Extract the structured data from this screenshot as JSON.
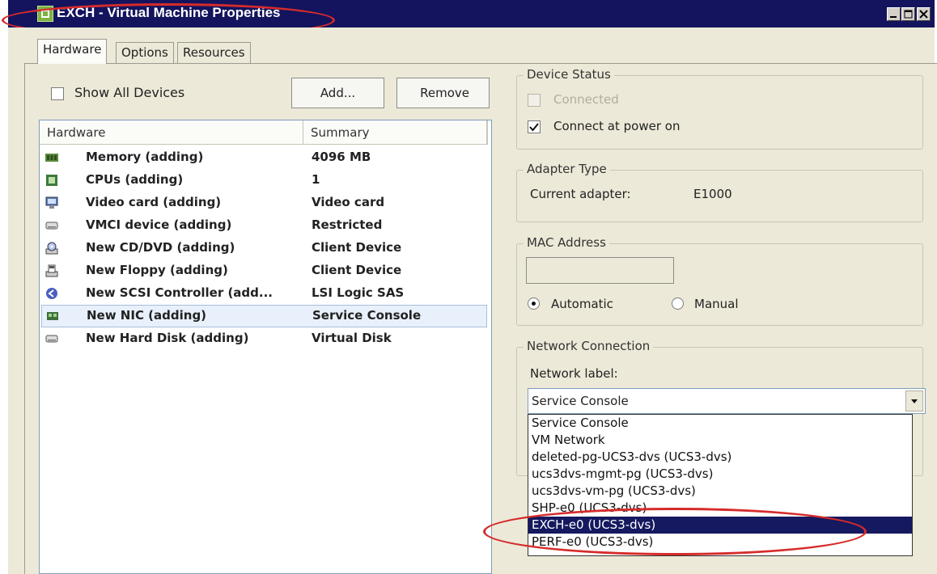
{
  "window": {
    "title": "EXCH - Virtual Machine Properties",
    "controls": {
      "minimize": "_",
      "maximize": "□",
      "close": "×"
    }
  },
  "tabs": [
    {
      "label": "Hardware",
      "active": true
    },
    {
      "label": "Options",
      "active": false
    },
    {
      "label": "Resources",
      "active": false
    }
  ],
  "hardware_panel": {
    "show_all_devices_label": "Show All Devices",
    "show_all_devices_checked": false,
    "add_button": "Add...",
    "remove_button": "Remove",
    "columns": [
      "Hardware",
      "Summary"
    ],
    "rows": [
      {
        "icon": "memory-icon",
        "name": "Memory (adding)",
        "summary": "4096 MB"
      },
      {
        "icon": "cpu-icon",
        "name": "CPUs (adding)",
        "summary": "1"
      },
      {
        "icon": "video-card-icon",
        "name": "Video card  (adding)",
        "summary": "Video card"
      },
      {
        "icon": "vmci-device-icon",
        "name": "VMCI device (adding)",
        "summary": "Restricted"
      },
      {
        "icon": "cd-dvd-icon",
        "name": "New CD/DVD (adding)",
        "summary": "Client Device"
      },
      {
        "icon": "floppy-icon",
        "name": "New Floppy (adding)",
        "summary": "Client Device"
      },
      {
        "icon": "scsi-controller-icon",
        "name": "New SCSI Controller (add...",
        "summary": "LSI Logic SAS"
      },
      {
        "icon": "nic-icon",
        "name": "New NIC (adding)",
        "summary": "Service Console",
        "selected": true
      },
      {
        "icon": "hard-disk-icon",
        "name": "New Hard Disk (adding)",
        "summary": "Virtual Disk"
      }
    ]
  },
  "device_status": {
    "legend": "Device Status",
    "connected_label": "Connected",
    "connected_checked": false,
    "connected_enabled": false,
    "connect_at_power_on_label": "Connect at power on",
    "connect_at_power_on_checked": true
  },
  "adapter_type": {
    "legend": "Adapter Type",
    "current_adapter_label": "Current adapter:",
    "current_adapter_value": "E1000"
  },
  "mac_address": {
    "legend": "MAC Address",
    "value": "",
    "automatic_label": "Automatic",
    "manual_label": "Manual",
    "selected": "Automatic"
  },
  "network_connection": {
    "legend": "Network Connection",
    "network_label": "Network label:",
    "selected_value": "Service Console",
    "options": [
      "Service Console",
      "VM Network",
      "deleted-pg-UCS3-dvs (UCS3-dvs)",
      "ucs3dvs-mgmt-pg (UCS3-dvs)",
      "ucs3dvs-vm-pg (UCS3-dvs)",
      "SHP-e0 (UCS3-dvs)",
      "EXCH-e0 (UCS3-dvs)",
      "PERF-e0 (UCS3-dvs)"
    ],
    "highlighted_option": "EXCH-e0 (UCS3-dvs)"
  },
  "colors": {
    "titlebar": "#14145e",
    "dialog_bg": "#ece9d8",
    "selection": "#15195f",
    "annotation_red": "#d62b2b"
  }
}
